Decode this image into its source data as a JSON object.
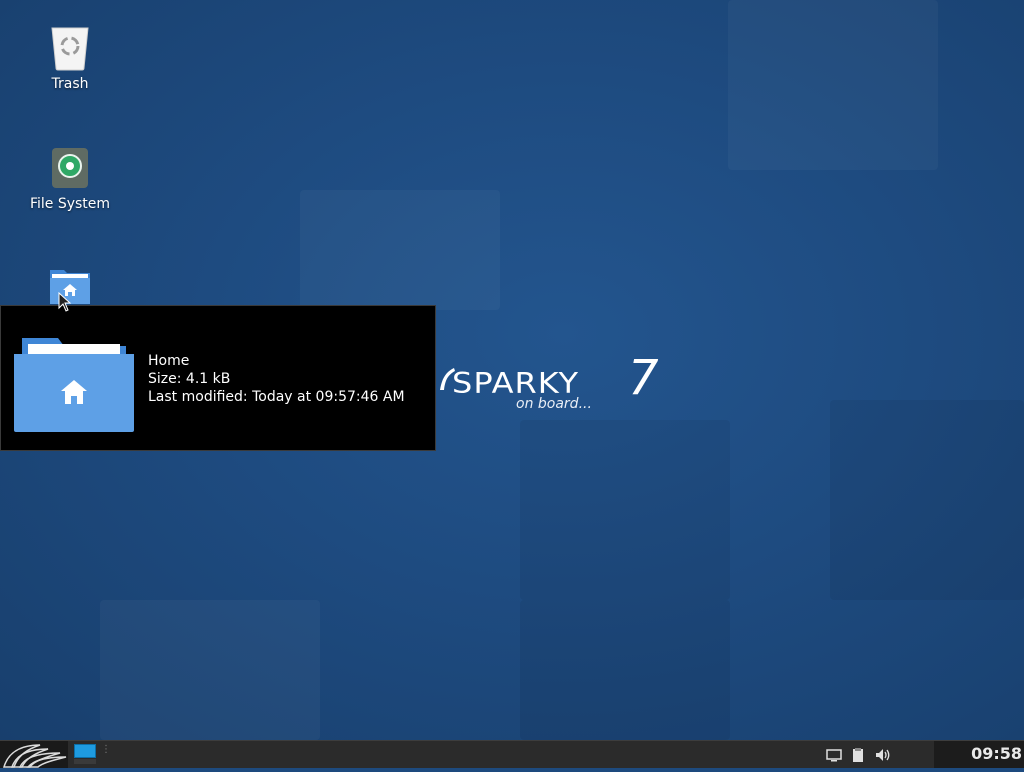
{
  "desktop": {
    "icons": [
      {
        "label": "Trash",
        "icon": "trash-icon"
      },
      {
        "label": "File System",
        "icon": "drive-icon"
      },
      {
        "label": "Home",
        "icon": "home-folder-icon"
      }
    ]
  },
  "wallpaper": {
    "brand": "SPARKY",
    "version": "7",
    "tagline": "on board..."
  },
  "tooltip": {
    "name": "Home",
    "size": "Size: 4.1 kB",
    "modified": "Last modified: Today at 09:57:46 AM",
    "icon": "home-folder-icon"
  },
  "taskbar": {
    "menu_icon": "sparky-menu-icon",
    "workspace_icon": "workspace-switcher-icon",
    "tray_icons": [
      "display-icon",
      "clipboard-icon",
      "volume-icon"
    ],
    "clock": "09:58"
  },
  "colors": {
    "desktop_bg": "#1d4a7e",
    "folder_blue": "#5ea0e6",
    "taskbar": "#2b2b2b",
    "workspace_active": "#1e9be0"
  }
}
